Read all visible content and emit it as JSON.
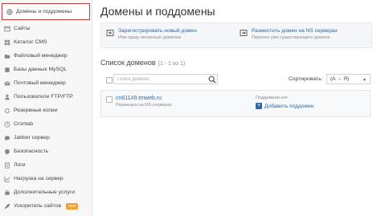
{
  "sidebar": {
    "items": [
      {
        "label": "Домены и поддомены",
        "icon": "globe-icon"
      },
      {
        "label": "Сайты",
        "icon": "sites-icon"
      },
      {
        "label": "Каталог CMS",
        "icon": "cms-icon"
      },
      {
        "label": "Файловый менеджер",
        "icon": "folder-icon"
      },
      {
        "label": "Базы данных MySQL",
        "icon": "database-icon"
      },
      {
        "label": "Почтовый менеджер",
        "icon": "mail-icon"
      },
      {
        "label": "Пользователи FTP/FTP",
        "icon": "ftp-users-icon"
      },
      {
        "label": "Резервные копии",
        "icon": "backup-icon"
      },
      {
        "label": "Crontab",
        "icon": "clock-icon"
      },
      {
        "label": "Jabber сервер",
        "icon": "jabber-icon"
      },
      {
        "label": "Безопасность",
        "icon": "shield-icon"
      },
      {
        "label": "Логи",
        "icon": "logs-icon"
      },
      {
        "label": "Нагрузка на сервер",
        "icon": "chart-icon"
      },
      {
        "label": "Дополнительные услуги",
        "icon": "services-icon"
      },
      {
        "label": "Ускоритель сайтов",
        "icon": "rocket-icon"
      }
    ],
    "new_badge": "new"
  },
  "main": {
    "title": "Домены и поддомены",
    "actions": [
      {
        "title": "Зарегистрировать новый домен",
        "subtitle": "Или сразу несколько доменов"
      },
      {
        "title": "Разместить домен на NS серверах",
        "subtitle": "Перенос уже существующего домена"
      }
    ],
    "list_title": "Список доменов",
    "list_count": "(1 - 1 из 1)",
    "search_placeholder": "Поиск домена",
    "sort_label": "Сортировать:",
    "sort_value": "(A → Я)",
    "domains": [
      {
        "name": "cn61149.tmweb.ru",
        "status": "Размещен на NS-серверах",
        "subdomains_text": "Поддомени нет",
        "add_subdomain": "Добавить поддомен"
      }
    ]
  },
  "colors": {
    "accent": "#2a6aa8",
    "active_border": "#c23b3b",
    "badge": "#f0a030"
  }
}
